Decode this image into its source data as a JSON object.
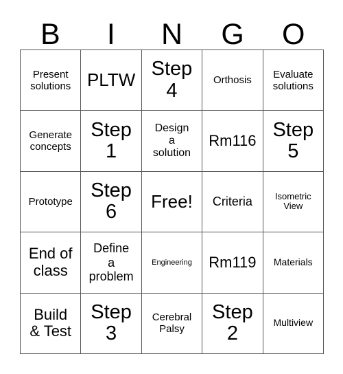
{
  "card": {
    "title_letters": [
      "B",
      "I",
      "N",
      "G",
      "O"
    ],
    "columns": 5,
    "rows": 5,
    "background_color": "#ffffff",
    "text_color": "#000000",
    "border_color": "#555555",
    "free_space_label": "Free!",
    "free_space_position": "row3-col3"
  },
  "cells": [
    {
      "text": "Present\nsolutions",
      "size": "fs-md"
    },
    {
      "text": "PLTW",
      "size": "fs-xxl"
    },
    {
      "text": "Step\n4",
      "size": "fs-huge"
    },
    {
      "text": "Orthosis",
      "size": "fs-md"
    },
    {
      "text": "Evaluate\nsolutions",
      "size": "fs-md"
    },
    {
      "text": "Generate\nconcepts",
      "size": "fs-md"
    },
    {
      "text": "Step\n1",
      "size": "fs-huge"
    },
    {
      "text": "Design\na\nsolution",
      "size": "fs-md2"
    },
    {
      "text": "Rm116",
      "size": "fs-xl"
    },
    {
      "text": "Step\n5",
      "size": "fs-huge"
    },
    {
      "text": "Prototype",
      "size": "fs-md"
    },
    {
      "text": "Step\n6",
      "size": "fs-huge"
    },
    {
      "text": "Free!",
      "size": "fs-xxl"
    },
    {
      "text": "Criteria",
      "size": "fs-lg"
    },
    {
      "text": "Isometric\nView",
      "size": "fs-sm"
    },
    {
      "text": "End of\nclass",
      "size": "fs-xl"
    },
    {
      "text": "Define\na\nproblem",
      "size": "fs-lg"
    },
    {
      "text": "Engineering",
      "size": "fs-xs"
    },
    {
      "text": "Rm119",
      "size": "fs-xl"
    },
    {
      "text": "Materials",
      "size": "fs-sm2"
    },
    {
      "text": "Build\n& Test",
      "size": "fs-xl"
    },
    {
      "text": "Step\n3",
      "size": "fs-huge"
    },
    {
      "text": "Cerebral\nPalsy",
      "size": "fs-md"
    },
    {
      "text": "Step\n2",
      "size": "fs-huge"
    },
    {
      "text": "Multiview",
      "size": "fs-sm2"
    }
  ]
}
